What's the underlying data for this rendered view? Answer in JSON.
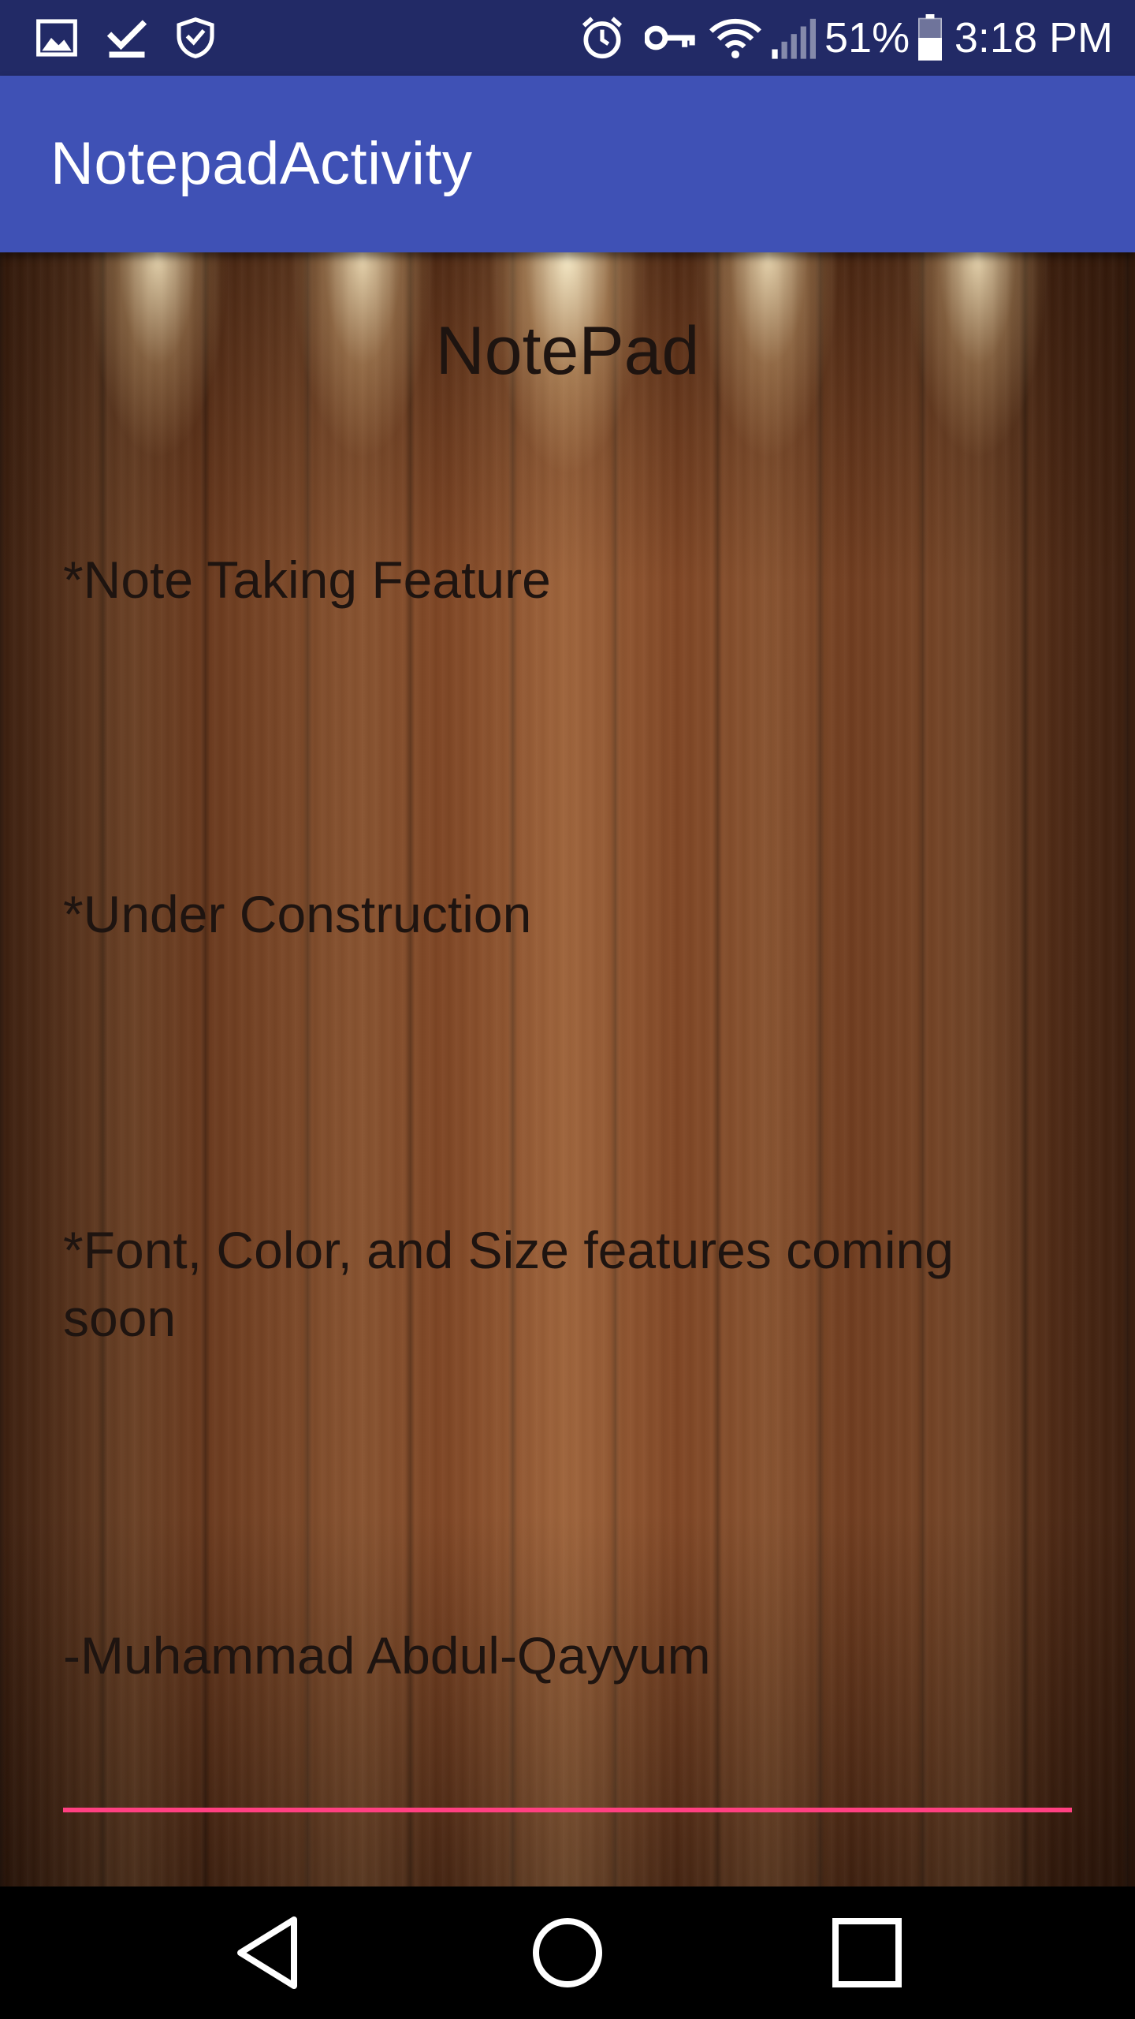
{
  "status_bar": {
    "icons_left": [
      "image-icon",
      "download-done-icon",
      "shield-icon"
    ],
    "icons_right": [
      "alarm-icon",
      "key-icon",
      "wifi-icon",
      "signal-icon",
      "battery-icon"
    ],
    "battery_percent": "51%",
    "time": "3:18 PM",
    "background_color": "#222a66"
  },
  "app_bar": {
    "title": "NotepadActivity",
    "background_color": "#3f51b5"
  },
  "note": {
    "heading": "NotePad",
    "lines": [
      "*Note Taking Feature",
      "*Under Construction",
      "*Font, Color, and Size features coming soon",
      "-Muhammad Abdul-Qayyum"
    ],
    "underline_color": "#ff4081"
  },
  "nav_bar": {
    "buttons": [
      "back-icon",
      "home-icon",
      "recents-icon"
    ]
  }
}
